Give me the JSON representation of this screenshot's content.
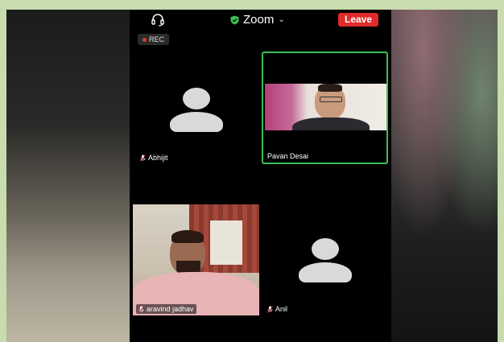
{
  "header": {
    "meeting_title": "Zoom",
    "leave_label": "Leave"
  },
  "recording": {
    "label": "REC"
  },
  "participants": [
    {
      "name": "Abhijit",
      "video": false,
      "muted": true
    },
    {
      "name": "Pavan Desai",
      "video": true,
      "active_speaker": true,
      "muted": false
    },
    {
      "name": "aravind jadhav",
      "video": true,
      "muted": true
    },
    {
      "name": "Anil",
      "video": false,
      "muted": true
    }
  ],
  "colors": {
    "leave_button": "#e02b2b",
    "active_speaker_border": "#3bbf55",
    "secure_shield": "#3bbf55",
    "rec_dot": "#e53935",
    "page_frame": "#c9dcae"
  },
  "icons": {
    "audio": "headset-icon",
    "secure": "shield-icon",
    "dropdown": "chevron-down-icon",
    "mute": "mic-muted-icon"
  }
}
